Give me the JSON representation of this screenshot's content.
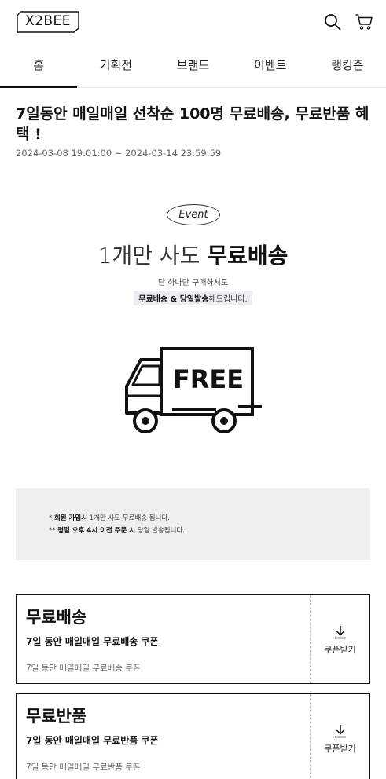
{
  "header": {
    "logo_text": "X2BEE",
    "search_icon": "search-icon",
    "cart_icon": "cart-icon"
  },
  "tabs": [
    {
      "label": "홈",
      "active": true
    },
    {
      "label": "기획전",
      "active": false
    },
    {
      "label": "브랜드",
      "active": false
    },
    {
      "label": "이벤트",
      "active": false
    },
    {
      "label": "랭킹존",
      "active": false
    }
  ],
  "event": {
    "title": "7일동안 매일매일 선착순 100명 무료배송, 무료반품 혜택 !",
    "period": "2024-03-08 19:01:00 ~ 2024-03-14 23:59:59",
    "banner": {
      "pill": "Event",
      "headline_thin": "1개만 사도",
      "headline_bold": "무료배송",
      "sub1": "단 하나만 구매하셔도",
      "sub2_bold": "무료배송 & 당일발송",
      "sub2_rest": "해드립니다.",
      "truck_text": "FREE",
      "truck_icon": "free-delivery-truck-icon"
    },
    "notice": {
      "line1_prefix": "* ",
      "line1_bold": "회원 가입시",
      "line1_rest": " 1개만 사도 무료배송 됩니다.",
      "line2_prefix": "** ",
      "line2_bold": "평일 오후 4시 이전 주문 시",
      "line2_rest": " 당일 발송됩니다."
    }
  },
  "coupons": [
    {
      "title": "무료배송",
      "name": "7일 동안 매일매일 무료배송 쿠폰",
      "desc": "7일 동안 매일매일 무료배송 쿠폰",
      "action": "쿠폰받기",
      "action_icon": "download-icon"
    },
    {
      "title": "무료반품",
      "name": "7일 동안 매일매일 무료반품 쿠폰",
      "desc": "7일 동안 매일매일 무료반품 쿠폰",
      "action": "쿠폰받기",
      "action_icon": "download-icon"
    }
  ]
}
